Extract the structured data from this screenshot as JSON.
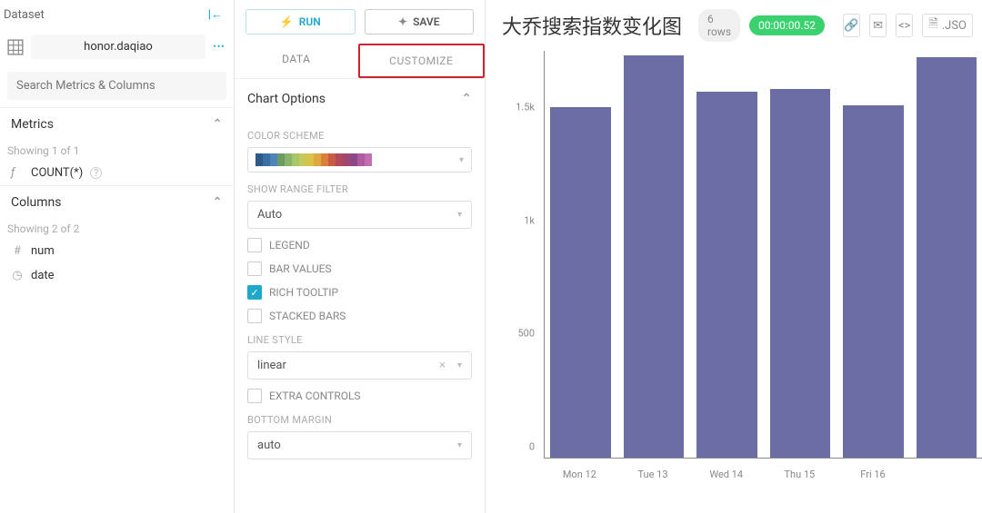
{
  "sidebar": {
    "header": "Dataset",
    "dataset_name": "honor.daqiao",
    "search_placeholder": "Search Metrics & Columns",
    "metrics_header": "Metrics",
    "metrics_showing": "Showing 1 of 1",
    "metric_label": "COUNT(*)",
    "columns_header": "Columns",
    "columns_showing": "Showing 2 of 2",
    "col_num": "num",
    "col_date": "date"
  },
  "mid": {
    "run_label": "RUN",
    "save_label": "SAVE",
    "tab_data": "DATA",
    "tab_customize": "CUSTOMIZE",
    "chart_options": "Chart Options",
    "color_scheme_label": "COLOR SCHEME",
    "swatch_colors": [
      "#2e5a8a",
      "#3b6fa3",
      "#4f84b8",
      "#6a9c64",
      "#8bb36a",
      "#a7c76f",
      "#c5c957",
      "#d9c14a",
      "#e0a93f",
      "#d87f3a",
      "#c85c48",
      "#b34a5b",
      "#a24772",
      "#8a4a8a",
      "#b05aa0",
      "#c26fb0"
    ],
    "range_filter_label": "SHOW RANGE FILTER",
    "range_filter_value": "Auto",
    "legend_label": "LEGEND",
    "bar_values_label": "BAR VALUES",
    "rich_tooltip_label": "RICH TOOLTIP",
    "stacked_bars_label": "STACKED BARS",
    "line_style_label": "LINE STYLE",
    "line_style_value": "linear",
    "extra_controls_label": "EXTRA CONTROLS",
    "bottom_margin_label": "BOTTOM MARGIN",
    "bottom_margin_value": "auto"
  },
  "chart": {
    "title": "大乔搜索指数变化图",
    "rows_label": "6 rows",
    "timer": "00:00:00.52",
    "json_label": ".JSO"
  },
  "chart_data": {
    "type": "bar",
    "title": "大乔搜索指数变化图",
    "xlabel": "",
    "ylabel": "",
    "ylim": [
      0,
      1800
    ],
    "yticks": [
      "0",
      "500",
      "1k",
      "1.5k"
    ],
    "categories": [
      "Mon 12",
      "Tue 13",
      "Wed 14",
      "Thu 15",
      "Fri 16",
      ""
    ],
    "values": [
      1550,
      1780,
      1620,
      1630,
      1560,
      1770
    ]
  }
}
